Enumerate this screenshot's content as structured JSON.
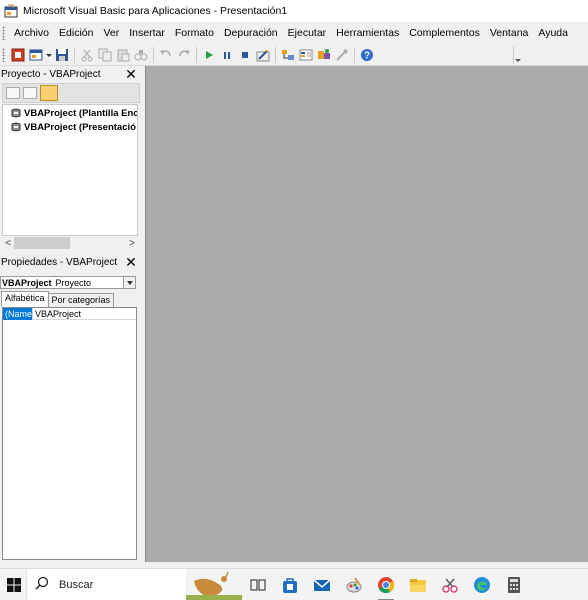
{
  "window": {
    "title": "Microsoft Visual Basic para Aplicaciones - Presentación1"
  },
  "menu": [
    "Archivo",
    "Edición",
    "Ver",
    "Insertar",
    "Formato",
    "Depuración",
    "Ejecutar",
    "Herramientas",
    "Complementos",
    "Ventana",
    "Ayuda"
  ],
  "project_explorer": {
    "title": "Proyecto - VBAProject",
    "items": [
      "VBAProject (Plantilla Enc",
      "VBAProject (Presentació"
    ]
  },
  "properties": {
    "title": "Propiedades - VBAProject",
    "object_name": "VBAProject",
    "object_type": "Proyecto",
    "tabs": [
      "Alfabética",
      "Por categorías"
    ],
    "rows": [
      {
        "name": "(Name)",
        "value": "VBAProject"
      }
    ]
  },
  "taskbar": {
    "search_placeholder": "Buscar"
  },
  "colors": {
    "workspace": "#ababab",
    "selection": "#0078d7"
  }
}
